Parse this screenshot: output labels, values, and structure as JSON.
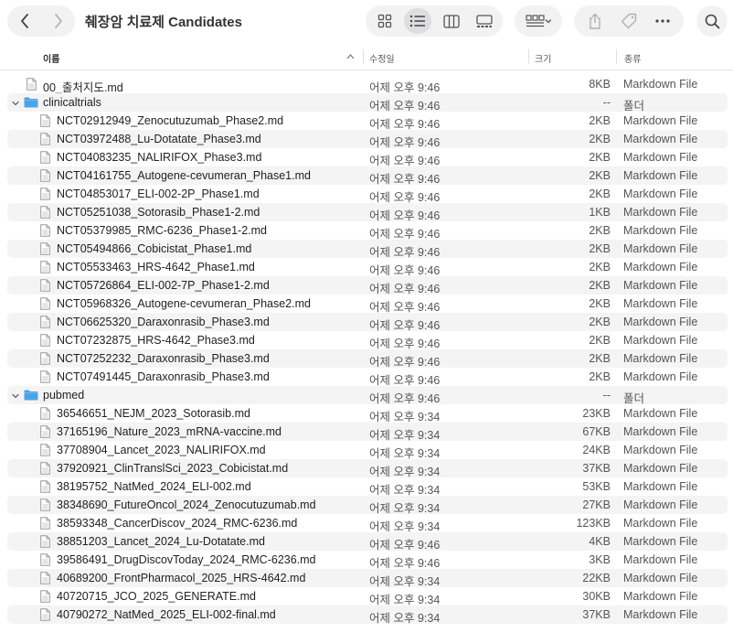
{
  "window": {
    "title": "췌장암 치료제 Candidates"
  },
  "toolbar": {
    "back_icon": "chevron-left-icon",
    "forward_icon": "chevron-right-icon",
    "views": [
      "icon-view",
      "list-view",
      "column-view",
      "gallery-view"
    ],
    "active_view": "list-view"
  },
  "columns": {
    "name": "이름",
    "modified": "수정일",
    "size": "크기",
    "kind": "종류"
  },
  "colors": {
    "folder": "#4aa4e8",
    "row_alt": "#f4f4f5",
    "active_view": "#dedee1"
  },
  "rows": [
    {
      "level": 0,
      "type": "file",
      "name": "00_출처지도.md",
      "modified": "어제 오후 9:46",
      "size": "8KB",
      "kind": "Markdown File"
    },
    {
      "level": 0,
      "type": "folder",
      "name": "clinicaltrials",
      "modified": "어제 오후 9:46",
      "size": "--",
      "kind": "폴더"
    },
    {
      "level": 1,
      "type": "file",
      "name": "NCT02912949_Zenocutuzumab_Phase2.md",
      "modified": "어제 오후 9:46",
      "size": "2KB",
      "kind": "Markdown File"
    },
    {
      "level": 1,
      "type": "file",
      "name": "NCT03972488_Lu-Dotatate_Phase3.md",
      "modified": "어제 오후 9:46",
      "size": "2KB",
      "kind": "Markdown File"
    },
    {
      "level": 1,
      "type": "file",
      "name": "NCT04083235_NALIRIFOX_Phase3.md",
      "modified": "어제 오후 9:46",
      "size": "2KB",
      "kind": "Markdown File"
    },
    {
      "level": 1,
      "type": "file",
      "name": "NCT04161755_Autogene-cevumeran_Phase1.md",
      "modified": "어제 오후 9:46",
      "size": "2KB",
      "kind": "Markdown File"
    },
    {
      "level": 1,
      "type": "file",
      "name": "NCT04853017_ELI-002-2P_Phase1.md",
      "modified": "어제 오후 9:46",
      "size": "2KB",
      "kind": "Markdown File"
    },
    {
      "level": 1,
      "type": "file",
      "name": "NCT05251038_Sotorasib_Phase1-2.md",
      "modified": "어제 오후 9:46",
      "size": "1KB",
      "kind": "Markdown File"
    },
    {
      "level": 1,
      "type": "file",
      "name": "NCT05379985_RMC-6236_Phase1-2.md",
      "modified": "어제 오후 9:46",
      "size": "2KB",
      "kind": "Markdown File"
    },
    {
      "level": 1,
      "type": "file",
      "name": "NCT05494866_Cobicistat_Phase1.md",
      "modified": "어제 오후 9:46",
      "size": "2KB",
      "kind": "Markdown File"
    },
    {
      "level": 1,
      "type": "file",
      "name": "NCT05533463_HRS-4642_Phase1.md",
      "modified": "어제 오후 9:46",
      "size": "2KB",
      "kind": "Markdown File"
    },
    {
      "level": 1,
      "type": "file",
      "name": "NCT05726864_ELI-002-7P_Phase1-2.md",
      "modified": "어제 오후 9:46",
      "size": "2KB",
      "kind": "Markdown File"
    },
    {
      "level": 1,
      "type": "file",
      "name": "NCT05968326_Autogene-cevumeran_Phase2.md",
      "modified": "어제 오후 9:46",
      "size": "2KB",
      "kind": "Markdown File"
    },
    {
      "level": 1,
      "type": "file",
      "name": "NCT06625320_Daraxonrasib_Phase3.md",
      "modified": "어제 오후 9:46",
      "size": "2KB",
      "kind": "Markdown File"
    },
    {
      "level": 1,
      "type": "file",
      "name": "NCT07232875_HRS-4642_Phase3.md",
      "modified": "어제 오후 9:46",
      "size": "2KB",
      "kind": "Markdown File"
    },
    {
      "level": 1,
      "type": "file",
      "name": "NCT07252232_Daraxonrasib_Phase3.md",
      "modified": "어제 오후 9:46",
      "size": "2KB",
      "kind": "Markdown File"
    },
    {
      "level": 1,
      "type": "file",
      "name": "NCT07491445_Daraxonrasib_Phase3.md",
      "modified": "어제 오후 9:46",
      "size": "2KB",
      "kind": "Markdown File"
    },
    {
      "level": 0,
      "type": "folder",
      "name": "pubmed",
      "modified": "어제 오후 9:46",
      "size": "--",
      "kind": "폴더"
    },
    {
      "level": 1,
      "type": "file",
      "name": "36546651_NEJM_2023_Sotorasib.md",
      "modified": "어제 오후 9:34",
      "size": "23KB",
      "kind": "Markdown File"
    },
    {
      "level": 1,
      "type": "file",
      "name": "37165196_Nature_2023_mRNA-vaccine.md",
      "modified": "어제 오후 9:34",
      "size": "67KB",
      "kind": "Markdown File"
    },
    {
      "level": 1,
      "type": "file",
      "name": "37708904_Lancet_2023_NALIRIFOX.md",
      "modified": "어제 오후 9:34",
      "size": "24KB",
      "kind": "Markdown File"
    },
    {
      "level": 1,
      "type": "file",
      "name": "37920921_ClinTranslSci_2023_Cobicistat.md",
      "modified": "어제 오후 9:34",
      "size": "37KB",
      "kind": "Markdown File"
    },
    {
      "level": 1,
      "type": "file",
      "name": "38195752_NatMed_2024_ELI-002.md",
      "modified": "어제 오후 9:34",
      "size": "53KB",
      "kind": "Markdown File"
    },
    {
      "level": 1,
      "type": "file",
      "name": "38348690_FutureOncol_2024_Zenocutuzumab.md",
      "modified": "어제 오후 9:34",
      "size": "27KB",
      "kind": "Markdown File"
    },
    {
      "level": 1,
      "type": "file",
      "name": "38593348_CancerDiscov_2024_RMC-6236.md",
      "modified": "어제 오후 9:34",
      "size": "123KB",
      "kind": "Markdown File"
    },
    {
      "level": 1,
      "type": "file",
      "name": "38851203_Lancet_2024_Lu-Dotatate.md",
      "modified": "어제 오후 9:46",
      "size": "4KB",
      "kind": "Markdown File"
    },
    {
      "level": 1,
      "type": "file",
      "name": "39586491_DrugDiscovToday_2024_RMC-6236.md",
      "modified": "어제 오후 9:46",
      "size": "3KB",
      "kind": "Markdown File"
    },
    {
      "level": 1,
      "type": "file",
      "name": "40689200_FrontPharmacol_2025_HRS-4642.md",
      "modified": "어제 오후 9:34",
      "size": "22KB",
      "kind": "Markdown File"
    },
    {
      "level": 1,
      "type": "file",
      "name": "40720715_JCO_2025_GENERATE.md",
      "modified": "어제 오후 9:34",
      "size": "30KB",
      "kind": "Markdown File"
    },
    {
      "level": 1,
      "type": "file",
      "name": "40790272_NatMed_2025_ELI-002-final.md",
      "modified": "어제 오후 9:34",
      "size": "37KB",
      "kind": "Markdown File"
    }
  ]
}
